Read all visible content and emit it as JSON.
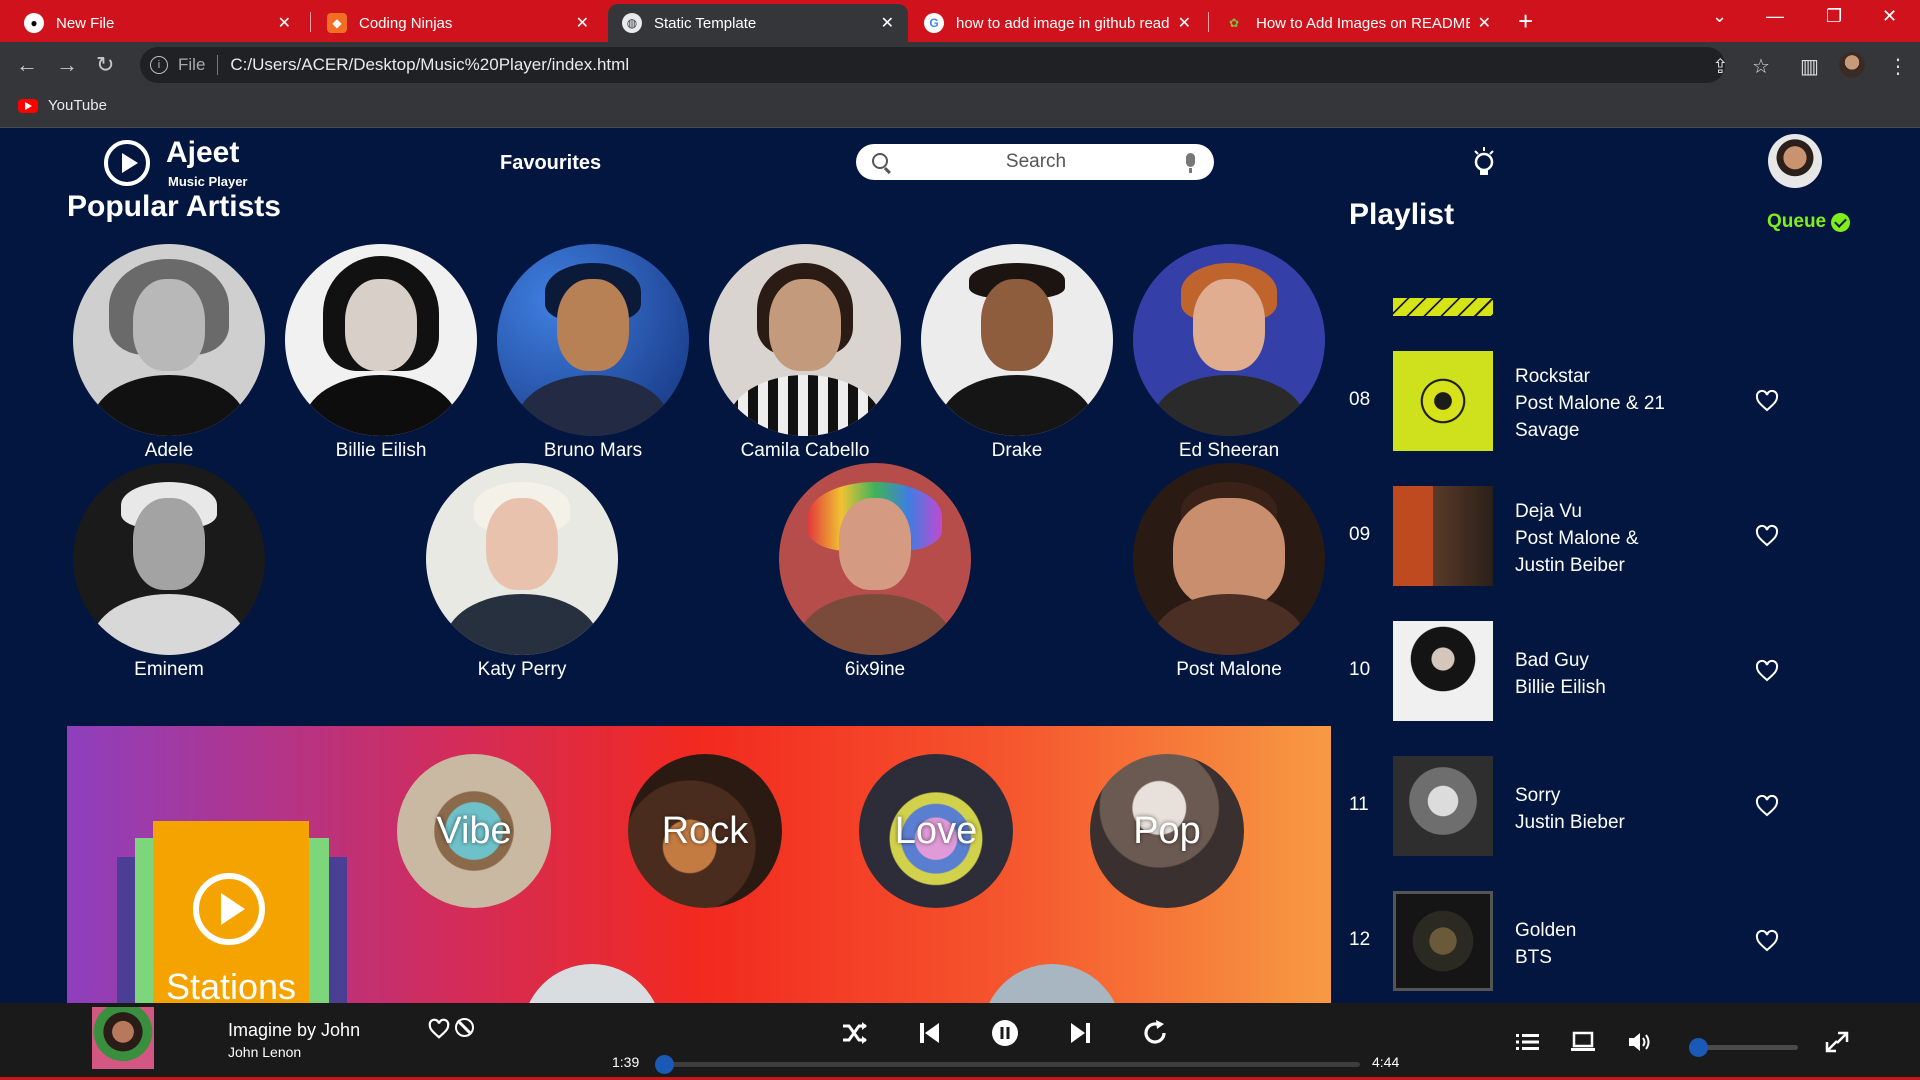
{
  "browser": {
    "tabs": [
      {
        "title": "New File",
        "favicon": "github-icon",
        "active": false
      },
      {
        "title": "Coding Ninjas",
        "favicon": "coding-ninjas-icon",
        "active": false
      },
      {
        "title": "Static Template",
        "favicon": "globe-icon",
        "active": true
      },
      {
        "title": "how to add image in github read",
        "favicon": "google-icon",
        "active": false
      },
      {
        "title": "How to Add Images on README",
        "favicon": "site-icon",
        "active": false
      }
    ],
    "address": {
      "scheme": "File",
      "url": "C:/Users/ACER/Desktop/Music%20Player/index.html"
    },
    "bookmarks": [
      {
        "label": "YouTube",
        "icon": "youtube-icon"
      }
    ],
    "colors": {
      "tabstrip": "#d0121c",
      "toolbar": "#35363a"
    }
  },
  "app": {
    "logo": {
      "title": "Ajeet",
      "subtitle": "Music Player"
    },
    "nav": {
      "favourites": "Favourites"
    },
    "search": {
      "placeholder": "Search"
    },
    "section_title": "Popular Artists",
    "artists_row1": [
      "Adele",
      "Billie Eilish",
      "Bruno Mars",
      "Camila Cabello",
      "Drake",
      "Ed Sheeran"
    ],
    "artists_row2": [
      "Eminem",
      "Katy Perry",
      "6ix9ine",
      "Post Malone"
    ],
    "stations": {
      "label": "Stations",
      "genres": [
        "Vibe",
        "Rock",
        "Love",
        "Pop"
      ]
    },
    "playlist": {
      "title": "Playlist",
      "queue_label": "Queue",
      "tracks": [
        {
          "num": "08",
          "title": "Rockstar",
          "artist": "Post Malone & 21 Savage"
        },
        {
          "num": "09",
          "title": "Deja Vu",
          "artist": "Post Malone & Justin Beiber"
        },
        {
          "num": "10",
          "title": "Bad Guy",
          "artist": "Billie Eilish"
        },
        {
          "num": "11",
          "title": "Sorry",
          "artist": "Justin Bieber"
        },
        {
          "num": "12",
          "title": "Golden",
          "artist": "BTS"
        }
      ]
    },
    "colors": {
      "background": "#03163f",
      "accent_green": "#7fee1d",
      "accent_blue": "#1a59b5"
    }
  },
  "player": {
    "now_playing": {
      "title": "Imagine by John",
      "artist": "John Lenon"
    },
    "elapsed": "1:39",
    "duration": "4:44",
    "progress": 0,
    "volume": 0
  }
}
